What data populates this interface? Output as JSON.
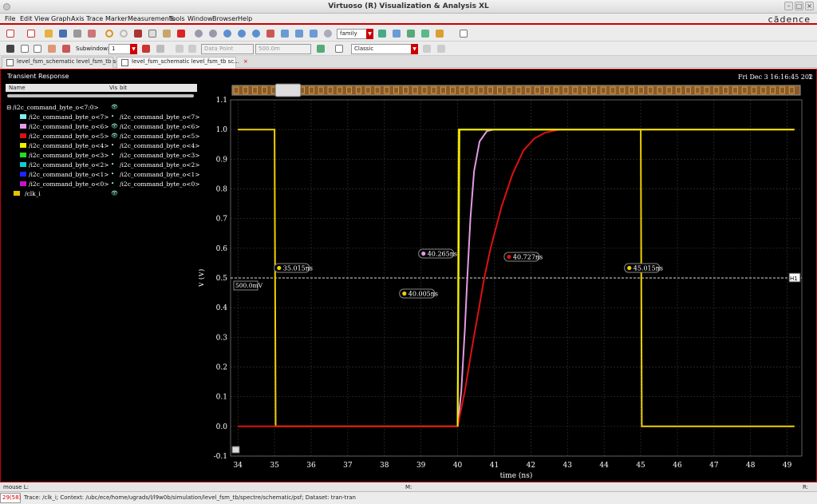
{
  "window": {
    "title": "Virtuoso (R) Visualization & Analysis XL",
    "brand": "cādence"
  },
  "menu": [
    "File",
    "Edit",
    "View",
    "Graph",
    "Axis",
    "Trace",
    "Marker",
    "Measurements",
    "Tools",
    "Window",
    "Browser",
    "Help"
  ],
  "toolbar": {
    "family_combo": "family",
    "subwindow_label": "Subwindow:",
    "subwindow_value": "1",
    "datapoint_combo": "Data Point",
    "value_combo": "500.0m",
    "style_combo": "Classic"
  },
  "tabs": [
    {
      "label": "level_fsm_schematic level_fsm_tb sc..."
    },
    {
      "label": "level_fsm_schematic level_fsm_tb sc..."
    }
  ],
  "sidebar": {
    "title": "Transient Response",
    "col_name": "Name",
    "col_vis": "Vis",
    "col_bit": "bit",
    "bus": {
      "name": "/i2c_command_byte_o<7:0>"
    },
    "signals": [
      {
        "name": "/i2c_command_byte_o<7>",
        "bit": "/i2c_command_byte_o<7>",
        "color": "#7ff0f0",
        "vis": "•"
      },
      {
        "name": "/i2c_command_byte_o<6>",
        "bit": "/i2c_command_byte_o<6>",
        "color": "#e49be4",
        "vis": "👁"
      },
      {
        "name": "/i2c_command_byte_o<5>",
        "bit": "/i2c_command_byte_o<5>",
        "color": "#d11",
        "vis": "👁"
      },
      {
        "name": "/i2c_command_byte_o<4>",
        "bit": "/i2c_command_byte_o<4>",
        "color": "#f0f000",
        "vis": "•"
      },
      {
        "name": "/i2c_command_byte_o<3>",
        "bit": "/i2c_command_byte_o<3>",
        "color": "#2d2",
        "vis": "•"
      },
      {
        "name": "/i2c_command_byte_o<2>",
        "bit": "/i2c_command_byte_o<2>",
        "color": "#1cc",
        "vis": "•"
      },
      {
        "name": "/i2c_command_byte_o<1>",
        "bit": "/i2c_command_byte_o<1>",
        "color": "#22f",
        "vis": "•"
      },
      {
        "name": "/i2c_command_byte_o<0>",
        "bit": "/i2c_command_byte_o<0>",
        "color": "#c1c",
        "vis": "•"
      }
    ],
    "clk": {
      "name": "/clk_i",
      "color": "#e8c400"
    }
  },
  "plot": {
    "timestamp": "Fri Dec 3 16:16:45 2021",
    "corner_label": "1",
    "h_marker_label": "H1",
    "h_marker_value": "500.0mV",
    "markers": [
      {
        "label": "35.015ns",
        "color": "#f0d000"
      },
      {
        "label": "40.265ns",
        "color": "#e49be4"
      },
      {
        "label": "40.727ns",
        "color": "#d11"
      },
      {
        "label": "40.005ns",
        "color": "#f0d000"
      },
      {
        "label": "45.015ns",
        "color": "#f0d000"
      }
    ]
  },
  "chart_data": {
    "type": "line",
    "xlabel": "time (ns)",
    "ylabel": "V (V)",
    "xlim": [
      33.8,
      49.4
    ],
    "ylim": [
      -0.1,
      1.1
    ],
    "xticks": [
      34,
      35,
      36,
      37,
      38,
      39,
      40,
      41,
      42,
      43,
      44,
      45,
      46,
      47,
      48,
      49
    ],
    "yticks": [
      -0.1,
      0.0,
      0.1,
      0.2,
      0.3,
      0.4,
      0.5,
      0.6,
      0.7,
      0.8,
      0.9,
      1.0,
      1.1
    ],
    "ytick_labels": [
      "-0.1",
      "0.0",
      "0.1",
      "0.2",
      "0.3",
      "0.4",
      "0.5",
      "0.6",
      "0.7",
      "0.8",
      "0.9",
      "1.0",
      "1.1"
    ],
    "series": [
      {
        "name": "/clk_i",
        "color": "#f0d000",
        "x": [
          34,
          35.0,
          35.03,
          40.0,
          40.03,
          45.0,
          45.03,
          49.2
        ],
        "y": [
          1.0,
          1.0,
          0.0,
          0.0,
          1.0,
          1.0,
          0.0,
          0.0
        ]
      },
      {
        "name": "/i2c_command_byte_o<6>",
        "color": "#e49be4",
        "x": [
          40.0,
          40.1,
          40.2,
          40.265,
          40.35,
          40.45,
          40.6,
          40.8,
          41.0
        ],
        "y": [
          0.0,
          0.12,
          0.33,
          0.5,
          0.7,
          0.86,
          0.96,
          0.995,
          1.0
        ]
      },
      {
        "name": "/i2c_command_byte_o<5>",
        "color": "#d11",
        "x": [
          34,
          40.0,
          40.2,
          40.4,
          40.6,
          40.727,
          40.9,
          41.2,
          41.5,
          41.8,
          42.1,
          42.4,
          42.8,
          49.2
        ],
        "y": [
          0.0,
          0.0,
          0.12,
          0.27,
          0.41,
          0.5,
          0.6,
          0.74,
          0.85,
          0.93,
          0.97,
          0.99,
          1.0,
          1.0
        ]
      },
      {
        "name": "/i2c_command_byte_o<4>",
        "color": "#f0f000",
        "x": [
          40.0,
          40.05,
          40.3,
          40.6,
          49.2
        ],
        "y": [
          0.0,
          1.0,
          1.0,
          1.0,
          1.0
        ]
      }
    ],
    "h_marker": 0.5,
    "point_markers": [
      {
        "x": 35.015,
        "y": 0.5
      },
      {
        "x": 40.265,
        "y": 0.5
      },
      {
        "x": 40.727,
        "y": 0.5
      },
      {
        "x": 40.005,
        "y": 0.5
      },
      {
        "x": 45.015,
        "y": 0.5
      }
    ]
  },
  "status": {
    "left": "mouse L:",
    "mid": "M:",
    "right": "R:"
  },
  "trace_bar": {
    "count": "29(58)",
    "message": "Trace: /clk_i; Context: /ubc/ece/home/ugrads/l/l9w0b/simulation/level_fsm_tb/spectre/schematic/psf; Dataset: tran-tran"
  }
}
